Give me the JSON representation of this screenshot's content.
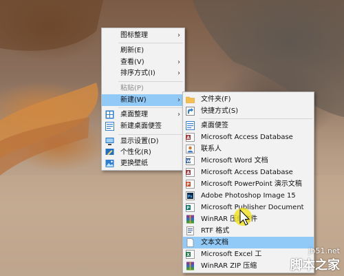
{
  "context_menu": {
    "items": [
      {
        "label": "图标整理",
        "has_submenu": true
      },
      {
        "label": "刷新(E)"
      },
      {
        "label": "查看(V)",
        "has_submenu": true
      },
      {
        "label": "排序方式(I)",
        "has_submenu": true
      },
      {
        "label": "粘贴(P)",
        "disabled": true
      },
      {
        "label": "新建(W)",
        "has_submenu": true,
        "highlighted": true
      },
      {
        "label": "桌面整理",
        "has_submenu": true,
        "icon": "desktop-organize-icon"
      },
      {
        "label": "新建桌面便签",
        "icon": "desktop-note-icon"
      },
      {
        "label": "显示设置(D)",
        "icon": "display-settings-icon"
      },
      {
        "label": "个性化(R)",
        "icon": "personalize-icon"
      },
      {
        "label": "更换壁纸",
        "icon": "wallpaper-icon"
      }
    ],
    "arrow_glyph": "›"
  },
  "new_submenu": {
    "items": [
      {
        "label": "文件夹(F)",
        "icon": "folder-icon"
      },
      {
        "label": "快捷方式(S)",
        "icon": "shortcut-icon"
      },
      {
        "label": "桌面便签",
        "icon": "sticky-note-icon"
      },
      {
        "label": "Microsoft Access Database",
        "icon": "access-icon"
      },
      {
        "label": "联系人",
        "icon": "contact-icon"
      },
      {
        "label": "Microsoft Word 文档",
        "icon": "word-icon"
      },
      {
        "label": "Microsoft Access Database",
        "icon": "access-icon"
      },
      {
        "label": "Microsoft PowerPoint 演示文稿",
        "icon": "powerpoint-icon"
      },
      {
        "label": "Adobe Photoshop Image 15",
        "icon": "photoshop-icon"
      },
      {
        "label": "Microsoft Publisher Document",
        "icon": "publisher-icon"
      },
      {
        "label": "WinRAR 压缩文件",
        "icon": "winrar-icon"
      },
      {
        "label": "RTF 格式",
        "icon": "rtf-icon"
      },
      {
        "label": "文本文档",
        "icon": "text-document-icon",
        "highlighted": true
      },
      {
        "label": "Microsoft Excel 工",
        "icon": "excel-icon"
      },
      {
        "label": "WinRAR ZIP 压缩",
        "icon": "winrar-zip-icon"
      }
    ]
  },
  "watermark": {
    "url": "jb51.net",
    "name": "脚本之家"
  },
  "colors": {
    "menu_bg": "#f2f2f2",
    "highlight": "#91c9f7",
    "cursor": "#f1e21a"
  }
}
